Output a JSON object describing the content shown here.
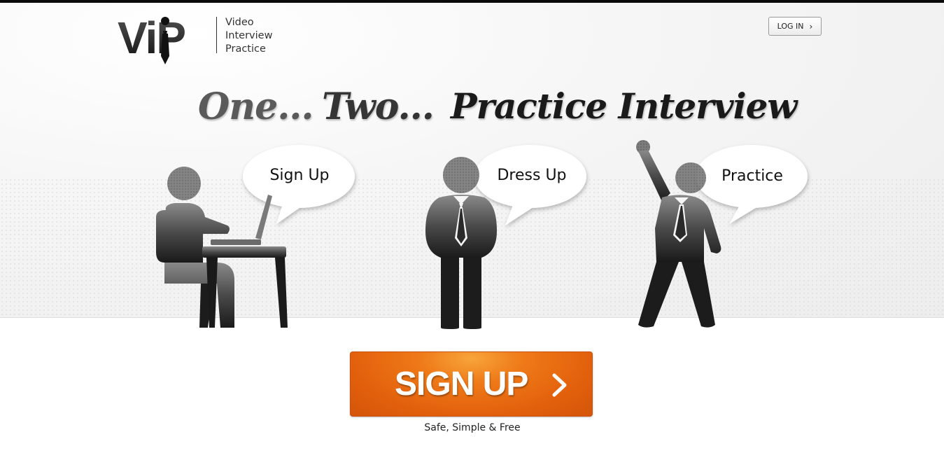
{
  "logo": {
    "mark_text": "ViP",
    "lines": [
      "Video",
      "Interview",
      "Practice"
    ]
  },
  "nav": {
    "login_label": "LOG IN",
    "login_icon": "chevron-right-icon"
  },
  "headline": {
    "word1": "One...",
    "word2": "Two...",
    "word3": "Practice Interview"
  },
  "steps": [
    {
      "label": "Sign Up",
      "icon": "person-at-laptop-icon"
    },
    {
      "label": "Dress Up",
      "icon": "person-with-tie-icon"
    },
    {
      "label": "Practice",
      "icon": "person-cheering-icon"
    }
  ],
  "cta": {
    "label": "SIGN UP",
    "icon": "chevron-right-icon",
    "tagline": "Safe, Simple & Free"
  },
  "colors": {
    "cta_orange": "#e8680f",
    "figure_gray": "#2e2e2e",
    "top_bar": "#0a0a0a"
  }
}
